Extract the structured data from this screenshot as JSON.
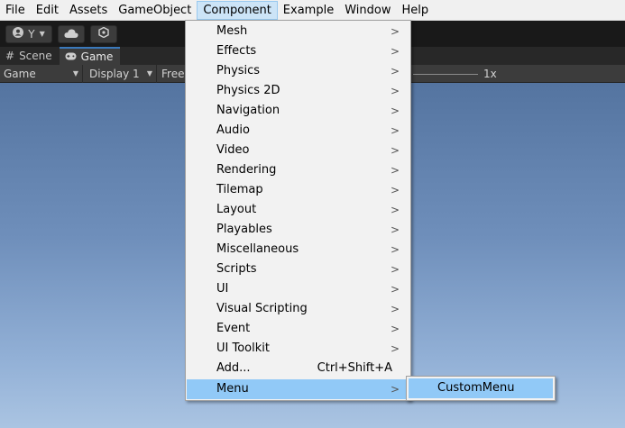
{
  "menubar": {
    "items": [
      "File",
      "Edit",
      "Assets",
      "GameObject",
      "Component",
      "Example",
      "Window",
      "Help"
    ]
  },
  "toolbar": {
    "account_label": "Y"
  },
  "tabs": [
    {
      "label": "Scene",
      "icon": "hash-icon"
    },
    {
      "label": "Game",
      "icon": "gamepad-icon"
    }
  ],
  "gamebar": {
    "view_label": "Game",
    "display_label": "Display 1",
    "aspect_label": "Free",
    "scale_label": "1x"
  },
  "component_menu": {
    "items": [
      {
        "label": "Mesh"
      },
      {
        "label": "Effects"
      },
      {
        "label": "Physics"
      },
      {
        "label": "Physics 2D"
      },
      {
        "label": "Navigation"
      },
      {
        "label": "Audio"
      },
      {
        "label": "Video"
      },
      {
        "label": "Rendering"
      },
      {
        "label": "Tilemap"
      },
      {
        "label": "Layout"
      },
      {
        "label": "Playables"
      },
      {
        "label": "Miscellaneous"
      },
      {
        "label": "Scripts"
      },
      {
        "label": "UI"
      },
      {
        "label": "Visual Scripting"
      },
      {
        "label": "Event"
      },
      {
        "label": "UI Toolkit"
      },
      {
        "label": "Add...",
        "shortcut": "Ctrl+Shift+A"
      },
      {
        "label": "Menu"
      }
    ]
  },
  "submenu": {
    "items": [
      {
        "label": "CustomMenu"
      }
    ]
  },
  "colors": {
    "menu_highlight": "#91c9f7",
    "menubar_active": "#cce4f7",
    "tab_accent": "#3a79bb"
  }
}
